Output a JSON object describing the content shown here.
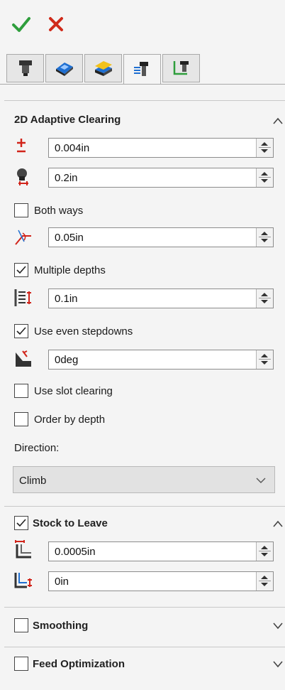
{
  "header": {
    "ok_icon": "green-check-icon",
    "cancel_icon": "red-x-icon"
  },
  "tabs": [
    {
      "icon": "tool-icon"
    },
    {
      "icon": "geometry-icon"
    },
    {
      "icon": "heights-icon"
    },
    {
      "icon": "passes-icon",
      "active": true
    },
    {
      "icon": "linking-icon"
    }
  ],
  "adaptive": {
    "title": "2D Adaptive Clearing",
    "tolerance": "0.004in",
    "optimal_load": "0.2in",
    "both_ways": "Both ways",
    "min_cutting_radius": "0.05in",
    "multiple_depths": "Multiple depths",
    "max_stepdown": "0.1in",
    "use_even_stepdowns": "Use even stepdowns",
    "wall_taper": "0deg",
    "use_slot_clearing": "Use slot clearing",
    "order_by_depth": "Order by depth",
    "direction_label": "Direction:",
    "direction_value": "Climb"
  },
  "stock": {
    "title": "Stock to Leave",
    "radial": "0.0005in",
    "axial": "0in"
  },
  "smoothing": {
    "title": "Smoothing"
  },
  "feed": {
    "title": "Feed Optimization"
  },
  "colors": {
    "check": "#2e9e3c",
    "cancel": "#d02a1a",
    "accent_red": "#d1241a",
    "accent_yellow": "#f2c21b",
    "accent_blue": "#1f6fd1"
  }
}
